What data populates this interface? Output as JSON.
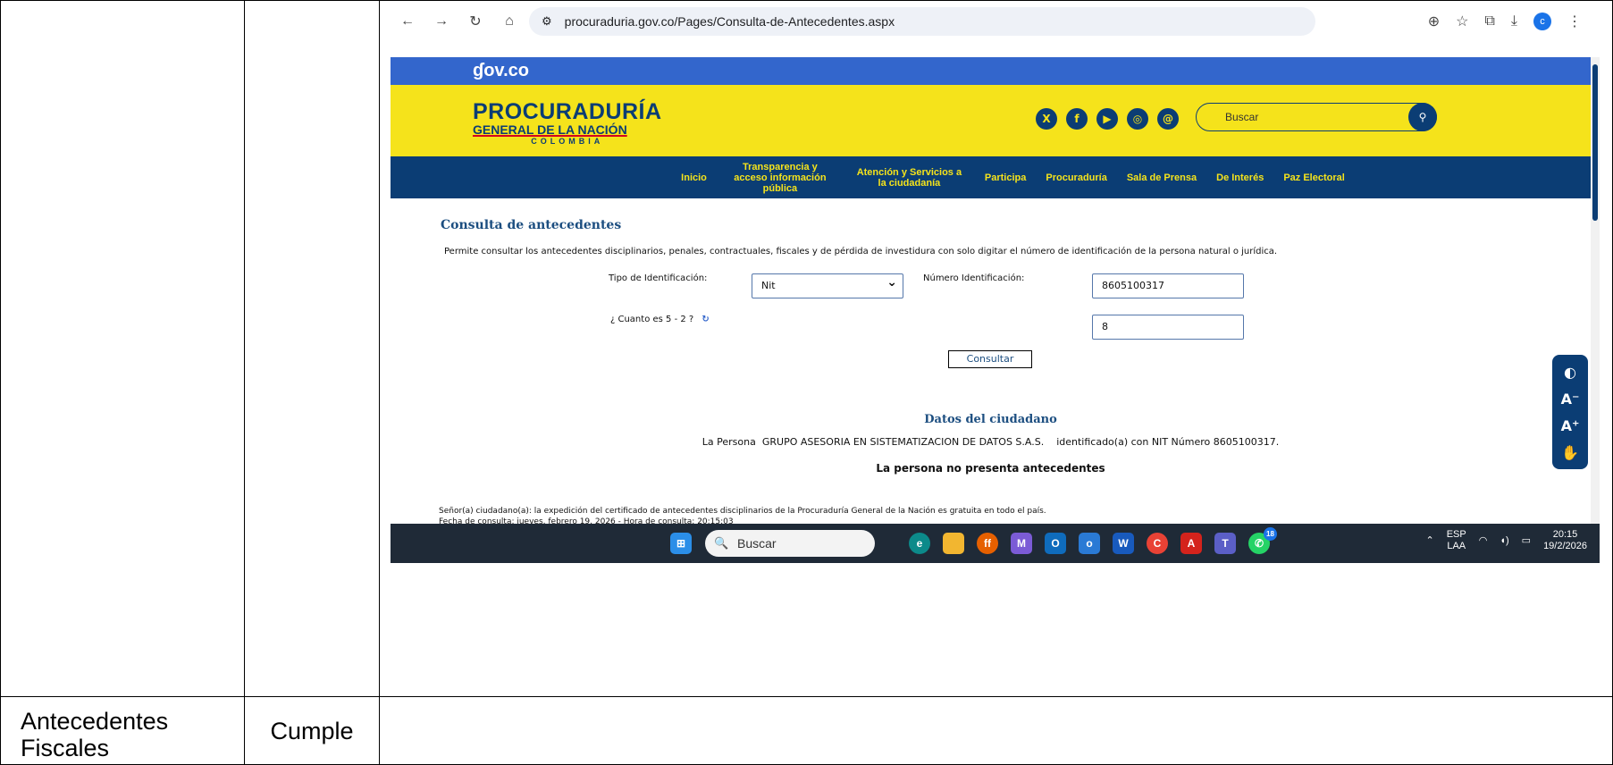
{
  "table": {
    "row_label_line1": "Antecedentes",
    "row_label_line2": "Fiscales",
    "row_status": "Cumple"
  },
  "browser": {
    "url": "procuraduria.gov.co/Pages/Consulta-de-Antecedentes.aspx",
    "profile_initial": "c"
  },
  "site": {
    "gov_logo": "ɠov.co",
    "brand_line1": "PROCURADURÍA",
    "brand_line2": "GENERAL DE LA NACIÓN",
    "brand_line3": "COLOMBIA",
    "search_placeholder": "Buscar",
    "nav": [
      "Inicio",
      "Transparencia y acceso información pública",
      "Atención y Servicios a la ciudadanía",
      "Participa",
      "Procuraduría",
      "Sala de Prensa",
      "De Interés",
      "Paz Electoral"
    ]
  },
  "form": {
    "title": "Consulta de antecedentes",
    "description": "Permite consultar los antecedentes disciplinarios, penales, contractuales, fiscales y de pérdida de investidura con solo digitar el número de identificación de la persona natural o jurídica.",
    "id_type_label": "Tipo de Identificación:",
    "id_type_value": "Nit",
    "id_number_label": "Número Identificación:",
    "id_number_value": "8605100317",
    "captcha_question": "¿ Cuanto es 5 - 2 ?",
    "captcha_answer": "8",
    "submit_label": "Consultar"
  },
  "result": {
    "title": "Datos del ciudadano",
    "person_text": "La Persona  GRUPO ASESORIA EN SISTEMATIZACION DE DATOS S.A.S.    identificado(a) con NIT Número 8605100317.",
    "status": "La persona no presenta antecedentes",
    "footer_line1": "Señor(a) ciudadano(a): la expedición del certificado de antecedentes disciplinarios de la Procuraduría General de la Nación es gratuita en todo el país.",
    "footer_line2": "Fecha de consulta: jueves, febrero 19, 2026 - Hora de consulta: 20:15:03"
  },
  "taskbar": {
    "search_placeholder": "Buscar",
    "lang": "ESP",
    "region": "LAA",
    "time": "20:15",
    "date": "19/2/2026",
    "whatsapp_badge": "18"
  }
}
